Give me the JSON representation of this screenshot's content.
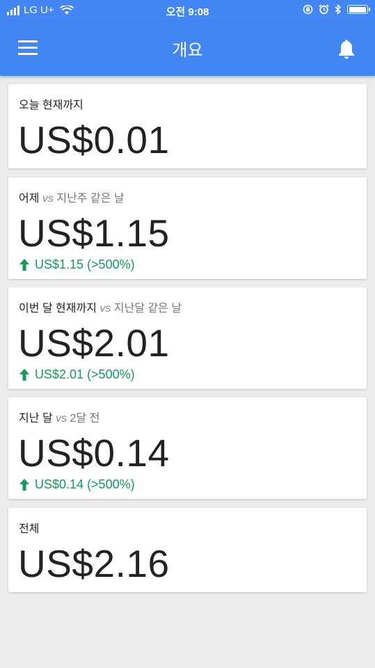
{
  "status_bar": {
    "carrier": "LG U+",
    "time": "오전 9:08"
  },
  "app_bar": {
    "title": "개요",
    "menu_icon": "menu-icon",
    "bell_icon": "bell-icon"
  },
  "colors": {
    "primary": "#4286f4",
    "positive": "#0f9d58",
    "background": "#ececec"
  },
  "cards": [
    {
      "label": "오늘 현재까지",
      "vs": "",
      "compare": "",
      "value": "US$0.01",
      "change": ""
    },
    {
      "label": "어제",
      "vs": "vs",
      "compare": "지난주 같은 날",
      "value": "US$1.15",
      "change": "US$1.15 (>500%)"
    },
    {
      "label": "이번 달 현재까지",
      "vs": "vs",
      "compare": "지난달 같은 날",
      "value": "US$2.01",
      "change": "US$2.01 (>500%)"
    },
    {
      "label": "지난 달",
      "vs": "vs",
      "compare": "2달 전",
      "value": "US$0.14",
      "change": "US$0.14 (>500%)"
    },
    {
      "label": "전체",
      "vs": "",
      "compare": "",
      "value": "US$2.16",
      "change": ""
    }
  ]
}
